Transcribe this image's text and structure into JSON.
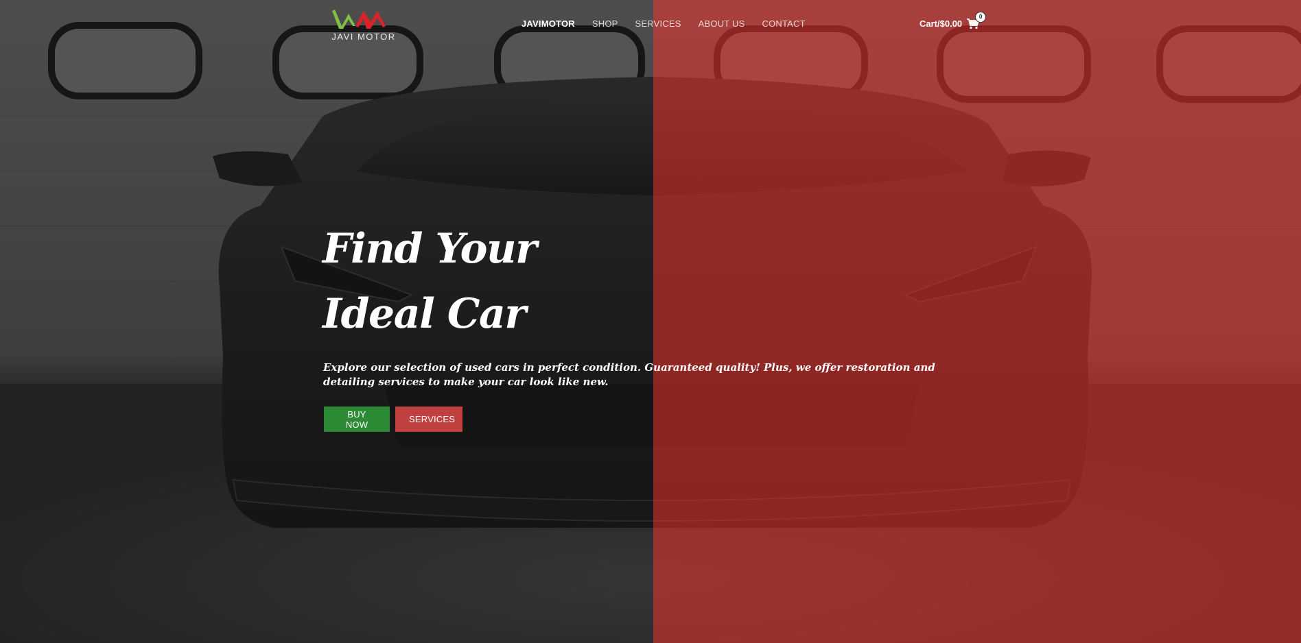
{
  "brand": {
    "name": "JAVI MOTOR",
    "logo_colors": [
      "#7ec242",
      "#d8232a"
    ]
  },
  "nav": {
    "items": [
      {
        "label": "JAVIMOTOR",
        "active": true
      },
      {
        "label": "SHOP",
        "active": false
      },
      {
        "label": "SERVICES",
        "active": false
      },
      {
        "label": "ABOUT US",
        "active": false
      },
      {
        "label": "CONTACT",
        "active": false
      }
    ]
  },
  "cart": {
    "label": "Cart/$0.00",
    "count": "0",
    "icon": "shopping-cart-icon"
  },
  "hero": {
    "headline_line1": "Find Your",
    "headline_line2": "Ideal Car",
    "subtitle": "Explore our selection of used cars in perfect condition. Guaranteed quality! Plus, we offer restoration and detailing services to make your car look like new.",
    "buttons": {
      "buy_now": "BUY NOW",
      "services": "SERVICES"
    },
    "background": "black sports car in garage",
    "overlay_colors": {
      "left": "#1c1c1c",
      "right": "#b02a28"
    },
    "button_colors": {
      "buy_now": "#2d8a34",
      "services": "#c0403f"
    }
  }
}
